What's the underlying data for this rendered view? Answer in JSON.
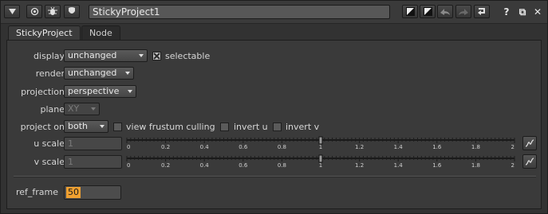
{
  "node_name": "StickyProject1",
  "tabs": [
    "StickyProject",
    "Node"
  ],
  "knobs": {
    "display": {
      "label": "display",
      "value": "unchanged",
      "selectable_label": "selectable",
      "selectable_checked": true
    },
    "render": {
      "label": "render",
      "value": "unchanged"
    },
    "projection": {
      "label": "projection",
      "value": "perspective"
    },
    "plane": {
      "label": "plane",
      "value": "XY",
      "disabled": true
    },
    "project_on": {
      "label": "project on",
      "value": "both",
      "view_frustum_culling": {
        "label": "view frustum culling",
        "checked": false
      },
      "invert_u": {
        "label": "invert u",
        "checked": false
      },
      "invert_v": {
        "label": "invert v",
        "checked": false
      }
    },
    "u_scale": {
      "label": "u scale",
      "value": "1"
    },
    "v_scale": {
      "label": "v scale",
      "value": "1"
    },
    "ref_frame": {
      "label": "ref_frame",
      "value": "50"
    }
  },
  "slider": {
    "min": 0,
    "max": 2,
    "tick_labels": [
      "0",
      "0.2",
      "0.4",
      "0.6",
      "0.8",
      "1",
      "1.2",
      "1.4",
      "1.6",
      "1.8",
      "2"
    ]
  },
  "titlebar_icons": [
    "collapse-arrow-icon",
    "viewer-circle-icon",
    "bug-icon",
    "node-color-icon",
    "default-color-icon",
    "node-color-swatch-icon",
    "undo-icon",
    "redo-icon",
    "revert-icon",
    "help-icon",
    "float-window-icon",
    "close-icon"
  ],
  "titlebar_text": {
    "help": "?",
    "float": "⧉",
    "close": "✕"
  },
  "colors": {
    "selection": "#f0a030",
    "panel": "#3a3a3a",
    "background": "#323232"
  }
}
